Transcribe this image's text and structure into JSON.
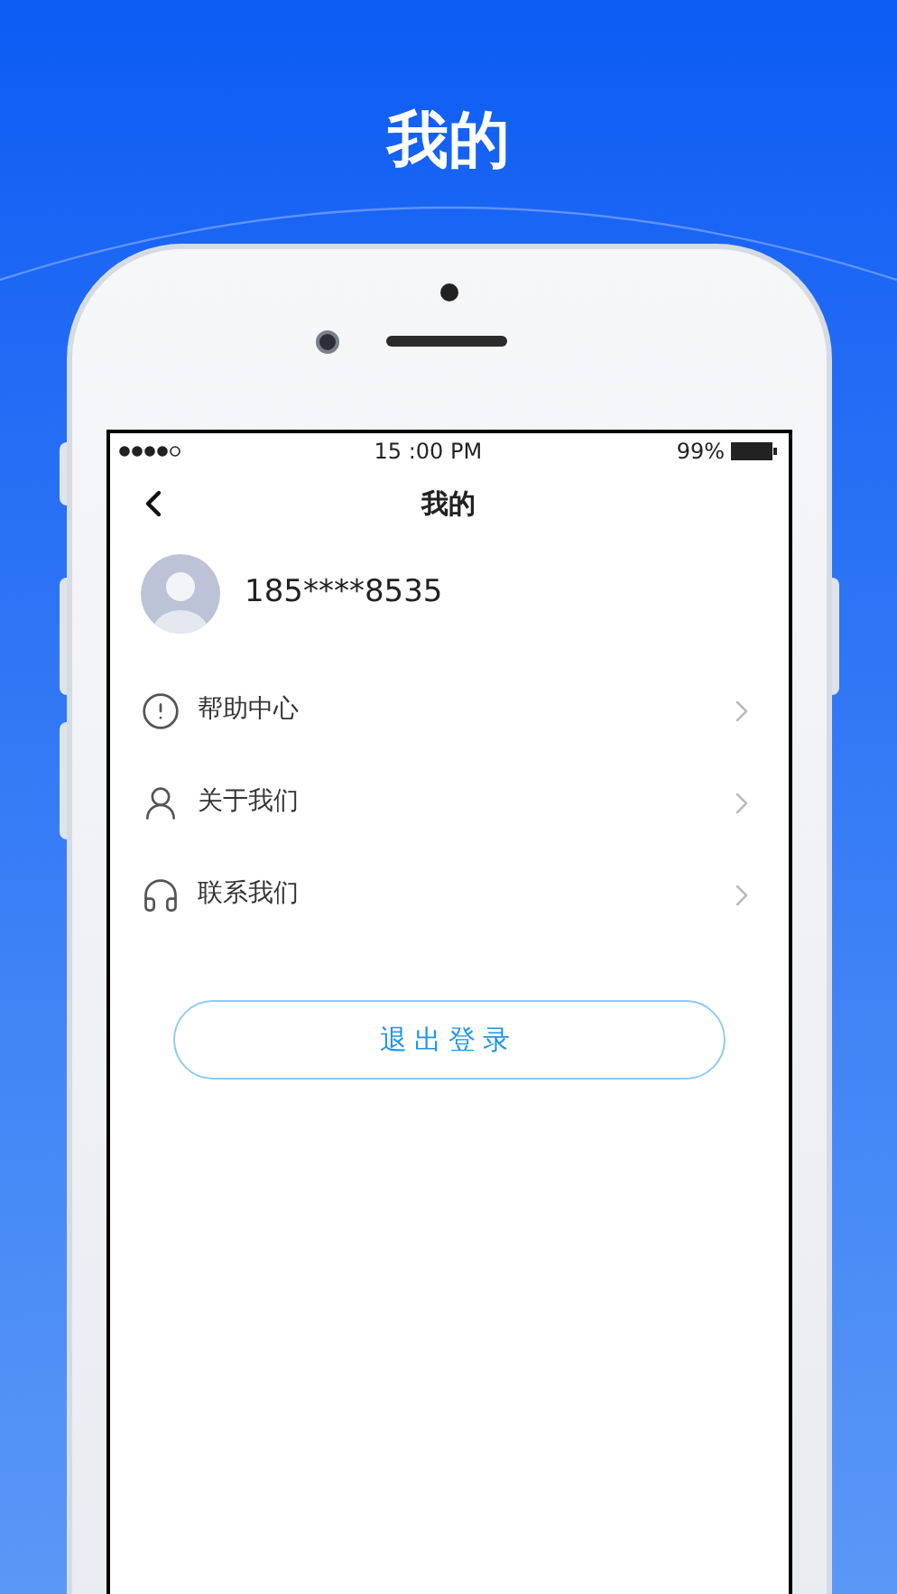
{
  "page_title": "我的",
  "status_bar": {
    "time": "15 :00 PM",
    "battery": "99%"
  },
  "nav": {
    "title": "我的"
  },
  "profile": {
    "phone": "185****8535"
  },
  "menu": [
    {
      "label": "帮助中心"
    },
    {
      "label": "关于我们"
    },
    {
      "label": "联系我们"
    }
  ],
  "logout_button": "退出登录"
}
